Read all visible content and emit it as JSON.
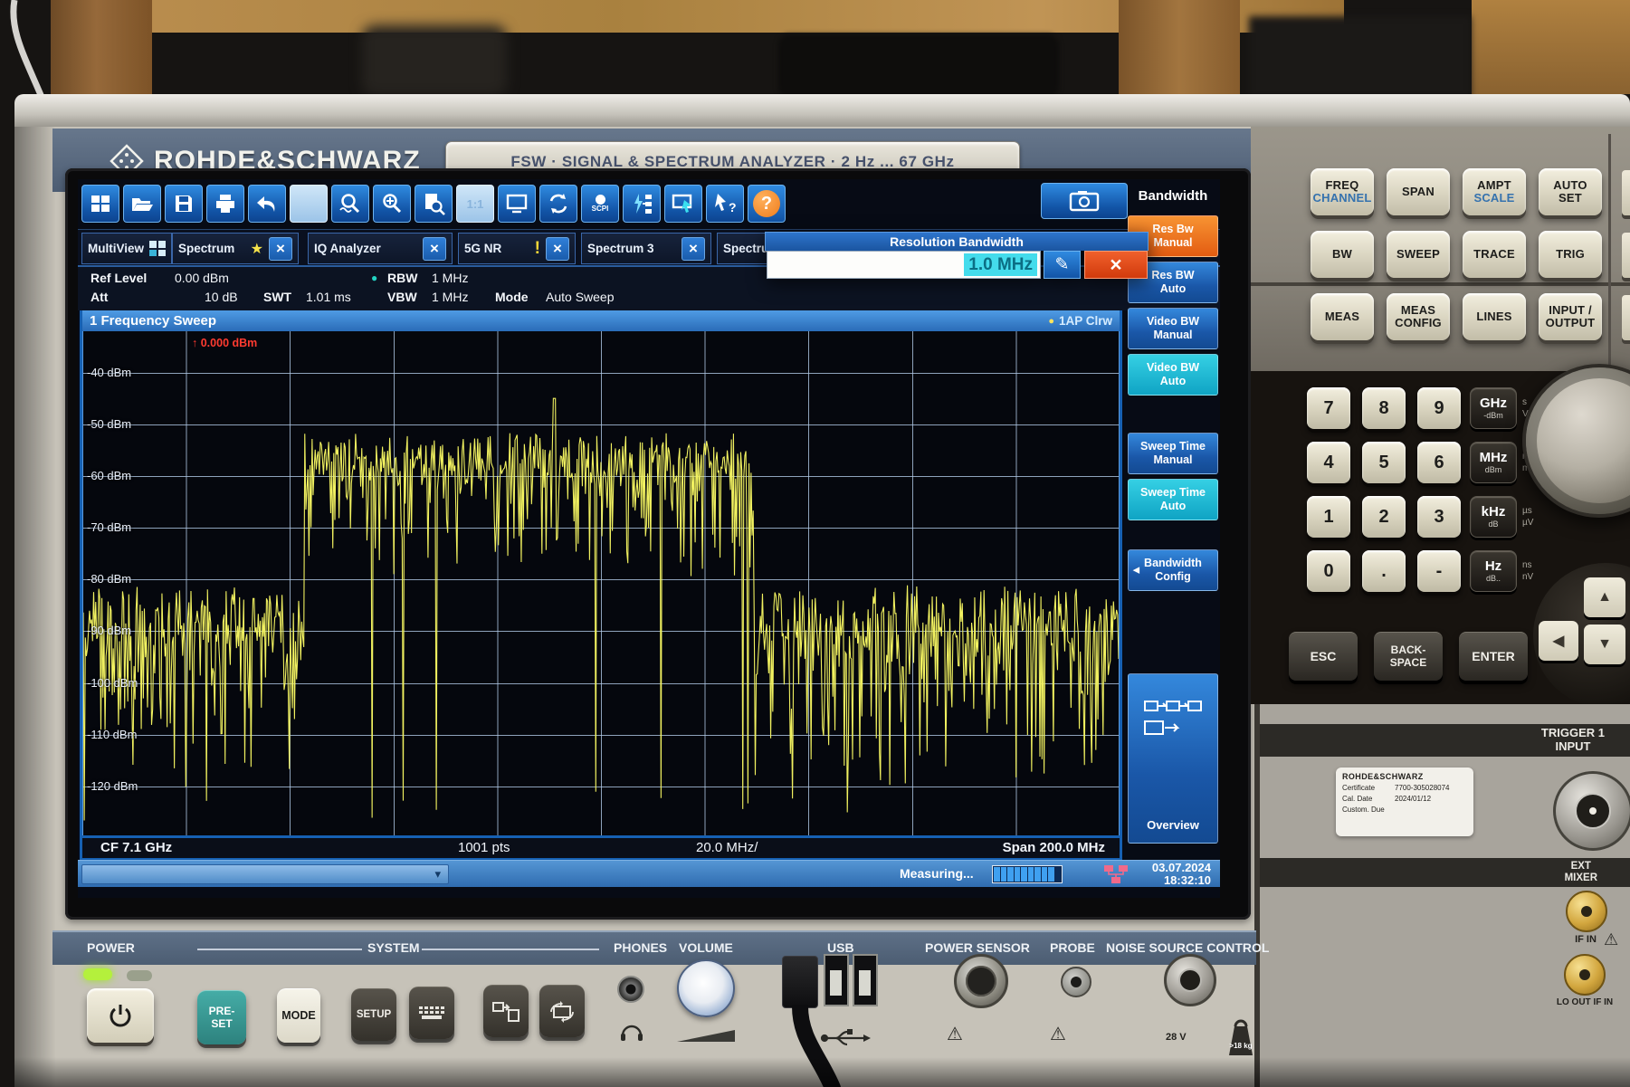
{
  "device": {
    "brand": "ROHDE&SCHWARZ",
    "model_plate": "FSW  ·  SIGNAL & SPECTRUM ANALYZER  ·  2 Hz ... 67 GHz"
  },
  "toolbar": {
    "scpi_label": "SCPI",
    "one_to_one_label": "1:1",
    "help_label": "?"
  },
  "tabs": {
    "items": [
      {
        "label": "MultiView"
      },
      {
        "label": "Spectrum"
      },
      {
        "label": "IQ Analyzer"
      },
      {
        "label": "5G NR"
      },
      {
        "label": "Spectrum 3"
      },
      {
        "label": "Spectrum"
      }
    ],
    "close_glyph": "×",
    "star_glyph": "★",
    "warn_glyph": "!"
  },
  "dialog": {
    "title": "Resolution Bandwidth",
    "value": "1.0 MHz",
    "edit_glyph": "✎",
    "close_glyph": "×"
  },
  "settings": {
    "ref_level_label": "Ref Level",
    "ref_level_value": "0.00 dBm",
    "rbw_label": "RBW",
    "rbw_value": "1 MHz",
    "att_label": "Att",
    "att_value": "10 dB",
    "swt_label": "SWT",
    "swt_value": "1.01 ms",
    "vbw_label": "VBW",
    "vbw_value": "1 MHz",
    "mode_label": "Mode",
    "mode_value": "Auto Sweep"
  },
  "window": {
    "title": "1 Frequency Sweep",
    "trace_dot": "●",
    "trace_label": "1AP Clrw"
  },
  "marker": {
    "glyph": "↑",
    "value": "0.000 dBm"
  },
  "chart_data": {
    "type": "line",
    "title": "1 Frequency Sweep",
    "trace_name": "1AP Clrw",
    "trace_color": "#f1f160",
    "x_axis": {
      "center_freq_ghz": 7.1,
      "span_mhz": 200.0,
      "mhz_per_div": 20.0,
      "points": 1001
    },
    "y_axis": {
      "unit": "dBm",
      "ticks": [
        -40,
        -50,
        -60,
        -70,
        -80,
        -90,
        -100,
        -110,
        -120
      ],
      "top_dbm": -32,
      "bottom_dbm": -129.5
    },
    "grid": {
      "h_divs": 10,
      "color": "#b0c9e6"
    },
    "signal": {
      "band_start_frac": 0.213,
      "band_end_frac": 0.648,
      "band_mean_dbm": -60,
      "band_jitter_up": 8.5,
      "band_jitter_down": 22,
      "floor_mean_dbm": -92.5,
      "floor_jitter_up": 11.5,
      "floor_jitter_down": 30,
      "deep_spike_prob": 0.01,
      "peak": {
        "frac": 0.455,
        "dbm": -45
      },
      "seed": 13
    }
  },
  "axis": {
    "cf": "CF 7.1 GHz",
    "pts": "1001 pts",
    "per_div": "20.0 MHz/",
    "span": "Span 200.0 MHz"
  },
  "status": {
    "dropdown_glyph": "▾",
    "measuring": "Measuring...",
    "progress_total": 10,
    "progress_filled": 9,
    "date": "03.07.2024",
    "time": "18:32:10"
  },
  "softkeys": {
    "header": "Bandwidth",
    "keys": [
      {
        "label": "Res Bw\nManual",
        "state": "orange"
      },
      {
        "label": "Res BW\nAuto",
        "state": "blue"
      },
      {
        "label": "Video BW\nManual",
        "state": "blue"
      },
      {
        "label": "Video BW\nAuto",
        "state": "teal"
      },
      {
        "label": "Sweep Time\nManual",
        "state": "blue",
        "gap": "gap-a"
      },
      {
        "label": "Sweep Time\nAuto",
        "state": "teal"
      },
      {
        "label": "Bandwidth\nConfig",
        "state": "blue",
        "gap": "gap-b",
        "marker": "◀"
      }
    ],
    "overview_label": "Overview"
  },
  "hardkeys": {
    "items": [
      {
        "l1": "FREQ",
        "l2": "CHANNEL",
        "cls": "accent"
      },
      {
        "l1": "SPAN"
      },
      {
        "l1": "AMPT",
        "l2": "SCALE",
        "cls": "accent"
      },
      {
        "l1": "AUTO",
        "l2": "SET"
      },
      {
        "l1": "BW"
      },
      {
        "l1": "SWEEP"
      },
      {
        "l1": "TRACE"
      },
      {
        "l1": "TRIG"
      },
      {
        "l1": "MEAS"
      },
      {
        "l1": "MEAS",
        "l2": "CONFIG"
      },
      {
        "l1": "LINES"
      },
      {
        "l1": "INPUT /",
        "l2": "OUTPUT"
      }
    ]
  },
  "keypad": {
    "digits": [
      "7",
      "8",
      "9",
      "4",
      "5",
      "6",
      "1",
      "2",
      "3",
      "0",
      ".",
      "-"
    ],
    "units": [
      {
        "label": "GHz",
        "sub": "-dBm",
        "side": "s\nV"
      },
      {
        "label": "MHz",
        "sub": "dBm",
        "side": "ms\nmV"
      },
      {
        "label": "kHz",
        "sub": "dB",
        "side": "µs\nµV"
      },
      {
        "label": "Hz",
        "sub": "dB..",
        "side": "ns\nnV"
      }
    ],
    "esc_keys": [
      "ESC",
      "BACK-\nSPACE",
      "ENTER"
    ],
    "arrows": {
      "up": "▲",
      "left": "◀",
      "down": "▼"
    }
  },
  "front_panel": {
    "power_label": "POWER",
    "system_label": "SYSTEM",
    "phones_label": "PHONES",
    "volume_label": "VOLUME",
    "usb_label": "USB",
    "power_sensor_label": "POWER SENSOR",
    "probe_label": "PROBE",
    "noise_label": "NOISE SOURCE CONTROL",
    "preset": "PRE-\nSET",
    "mode": "MODE",
    "setup": "SETUP",
    "warn_glyph": "⚠",
    "v28": "28 V",
    "weight": ">18 kg"
  },
  "right_module": {
    "trigger": "TRIGGER 1\nINPUT",
    "ext_mixer": "EXT\nMIXER",
    "if_in": "IF IN",
    "lo_out": "LO OUT IF IN",
    "warn_glyph": "⚠",
    "sticker": {
      "brand": "ROHDE&SCHWARZ",
      "cert_label": "Certificate",
      "cert_value": "7700-305028074",
      "cal_label": "Cal. Date",
      "cal_value": "2024/01/12",
      "due_label": "Custom. Due",
      "due_value": ""
    }
  }
}
